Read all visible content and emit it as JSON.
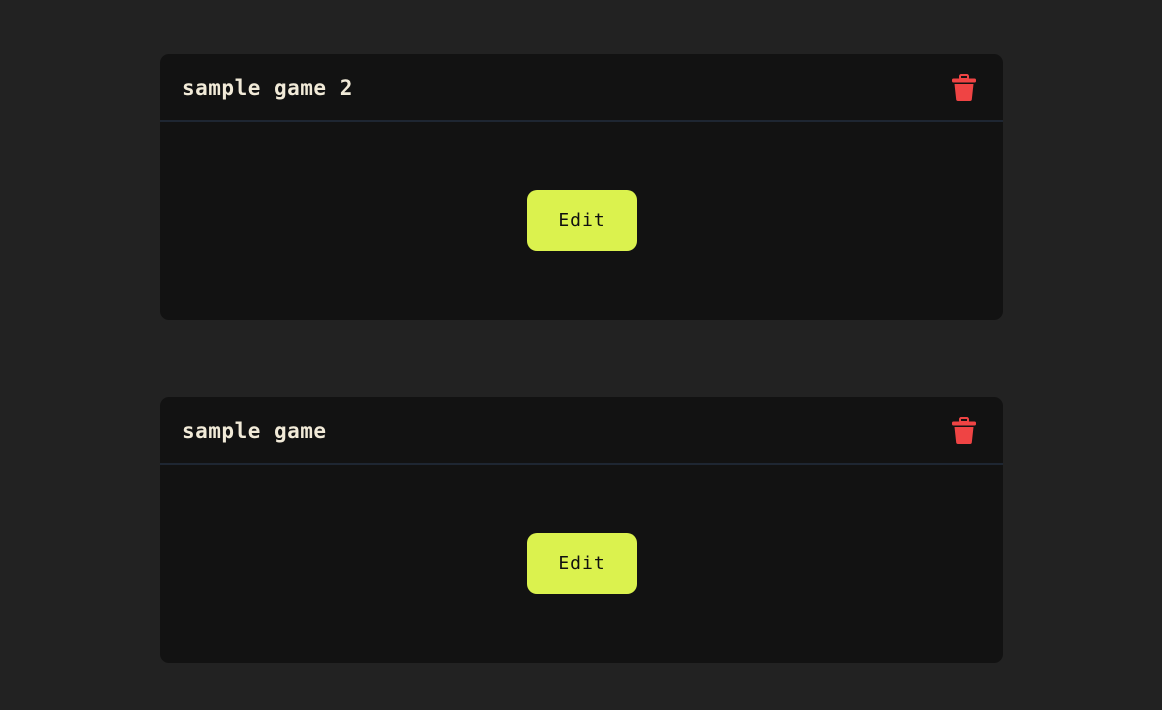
{
  "colors": {
    "page_background": "#222222",
    "card_background": "#121212",
    "divider": "#1e2632",
    "title_text": "#f1ead8",
    "accent": "#dbf24e",
    "delete": "#ef4444"
  },
  "games": [
    {
      "title": "sample game 2",
      "edit_label": "Edit",
      "delete_icon": "trash-icon"
    },
    {
      "title": "sample game",
      "edit_label": "Edit",
      "delete_icon": "trash-icon"
    }
  ]
}
